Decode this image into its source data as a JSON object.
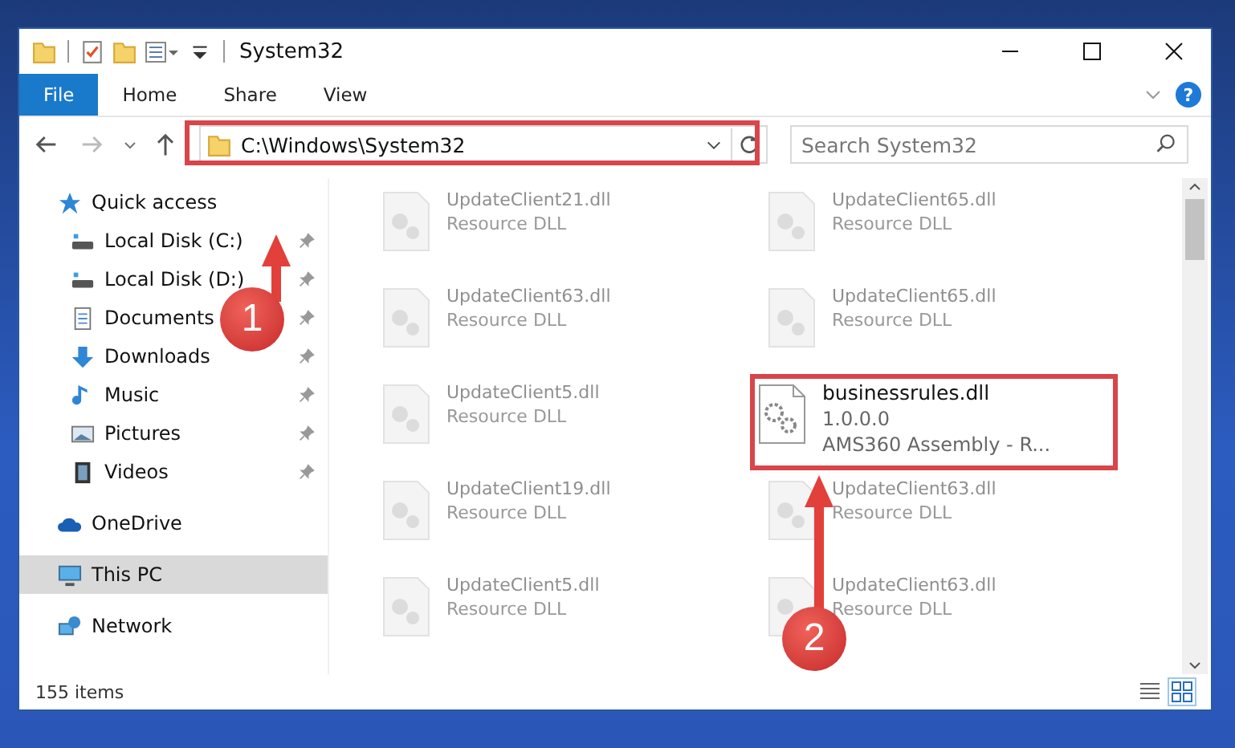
{
  "window": {
    "title": "System32"
  },
  "ribbon_tabs": [
    {
      "label": "File",
      "selected": true
    },
    {
      "label": "Home",
      "selected": false
    },
    {
      "label": "Share",
      "selected": false
    },
    {
      "label": "View",
      "selected": false
    }
  ],
  "help_button": {
    "label": "?"
  },
  "address_bar": {
    "value": "C:\\Windows\\System32"
  },
  "search": {
    "placeholder": "Search System32"
  },
  "sidebar": {
    "items": [
      {
        "kind": "section",
        "label": "Quick access",
        "pinned": false,
        "selected": false
      },
      {
        "kind": "entry",
        "label": "Local Disk (C:)",
        "pinned": true,
        "selected": false
      },
      {
        "kind": "entry",
        "label": "Local Disk (D:)",
        "pinned": true,
        "selected": false
      },
      {
        "kind": "entry",
        "label": "Documents",
        "pinned": true,
        "selected": false
      },
      {
        "kind": "entry",
        "label": "Downloads",
        "pinned": true,
        "selected": false
      },
      {
        "kind": "entry",
        "label": "Music",
        "pinned": true,
        "selected": false
      },
      {
        "kind": "entry",
        "label": "Pictures",
        "pinned": true,
        "selected": false
      },
      {
        "kind": "entry",
        "label": "Videos",
        "pinned": true,
        "selected": false
      },
      {
        "kind": "section",
        "label": "OneDrive",
        "pinned": false,
        "selected": false
      },
      {
        "kind": "section",
        "label": "This PC",
        "pinned": false,
        "selected": true
      },
      {
        "kind": "section",
        "label": "Network",
        "pinned": false,
        "selected": false
      }
    ]
  },
  "files": [
    {
      "kind": "dimmed",
      "name": "UpdateClient21.dll",
      "lines": [
        "Resource DLL"
      ]
    },
    {
      "kind": "dimmed",
      "name": "UpdateClient65.dll",
      "lines": [
        "Resource DLL"
      ]
    },
    {
      "kind": "dimmed",
      "name": "UpdateClient63.dll",
      "lines": [
        "Resource DLL"
      ]
    },
    {
      "kind": "dimmed",
      "name": "UpdateClient65.dll",
      "lines": [
        "Resource DLL"
      ]
    },
    {
      "kind": "dimmed",
      "name": "UpdateClient5.dll",
      "lines": [
        "Resource DLL"
      ]
    },
    {
      "kind": "highlighted",
      "name": "businessrules.dll",
      "lines": [
        "1.0.0.0",
        "AMS360 Assembly - R..."
      ]
    },
    {
      "kind": "dimmed",
      "name": "UpdateClient19.dll",
      "lines": [
        "Resource DLL"
      ]
    },
    {
      "kind": "dimmed",
      "name": "UpdateClient63.dll",
      "lines": [
        "Resource DLL"
      ]
    },
    {
      "kind": "dimmed",
      "name": "UpdateClient5.dll",
      "lines": [
        "Resource DLL"
      ]
    },
    {
      "kind": "dimmed",
      "name": "UpdateClient63.dll",
      "lines": [
        "Resource DLL"
      ]
    }
  ],
  "status_bar": {
    "text": "155 items"
  },
  "annotations": [
    {
      "number": "1"
    },
    {
      "number": "2"
    }
  ]
}
